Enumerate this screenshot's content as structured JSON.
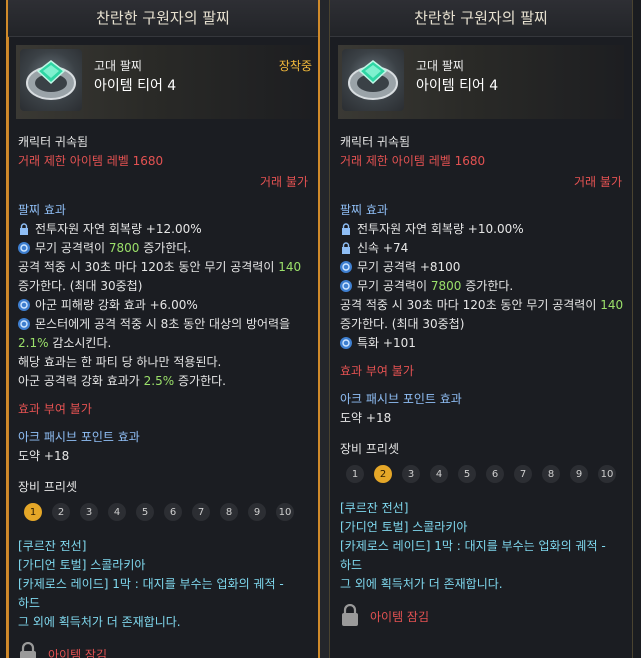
{
  "left_panel": {
    "title": "찬란한 구원자의 팔찌",
    "grade": "고대 팔찌",
    "tier": "아이템 티어 4",
    "equipped": "장착중",
    "bound": "캐릭터 귀속됨",
    "trade_level": "거래 제한 아이템 레벨 1680",
    "untradable": "거래 불가",
    "effect_header": "팔찌 효과",
    "effects": [
      {
        "icon": "lock-icon",
        "pre": "전투자원 자연 회복량 +12.00%",
        "val": "",
        "post": ""
      },
      {
        "icon": "swirl-icon",
        "pre": "무기 공격력이 ",
        "val": "7800",
        "post": " 증가한다."
      }
    ],
    "stack_line1_pre": "공격 적중 시 30초 마다 120초 동안 무기 공격력이 ",
    "stack_line1_val": "140",
    "stack_line2": "증가한다. (최대 30중첩)",
    "effect3": "아군 피해량 강화 효과 +6.00%",
    "effect4_line1": "몬스터에게 공격 적중 시 8초 동안 대상의 방어력을",
    "effect4_val": "2.1%",
    "effect4_post": " 감소시킨다.",
    "party_line": "해당 효과는 한 파티 당 하나만 적용된다.",
    "ally_pre": "아군 공격력 강화 효과가 ",
    "ally_val": "2.5%",
    "ally_post": " 증가한다.",
    "no_grant": "효과 부여 불가",
    "ark_header": "아크 패시브 포인트 효과",
    "ark_value": "도약 +18",
    "preset_header": "장비 프리셋",
    "presets": [
      "1",
      "2",
      "3",
      "4",
      "5",
      "6",
      "7",
      "8",
      "9",
      "10"
    ],
    "active_preset": 0,
    "source_header": "[쿠르잔 전선]",
    "source1": "[가디언 토벌] 스콜라키아",
    "source2_line1": "[카제로스 레이드] 1막 : 대지를 부수는 업화의 궤적 -",
    "source2_line2": "하드",
    "source_more": "그 외에 획득처가 더 존재합니다.",
    "lock_text": "아이템 잠김"
  },
  "right_panel": {
    "title": "찬란한 구원자의 팔찌",
    "grade": "고대 팔찌",
    "tier": "아이템 티어 4",
    "bound": "캐릭터 귀속됨",
    "trade_level": "거래 제한 아이템 레벨 1680",
    "untradable": "거래 불가",
    "effect_header": "팔찌 효과",
    "effects": [
      {
        "icon": "lock-icon",
        "pre": "전투자원 자연 회복량 +10.00%",
        "val": "",
        "post": ""
      },
      {
        "icon": "lock-icon",
        "pre": "신속 +74",
        "val": "",
        "post": ""
      },
      {
        "icon": "swirl-icon",
        "pre": "무기 공격력 +8100",
        "val": "",
        "post": ""
      },
      {
        "icon": "swirl-icon",
        "pre": "무기 공격력이 ",
        "val": "7800",
        "post": " 증가한다."
      }
    ],
    "stack_line1_pre": "공격 적중 시 30초 마다 120초 동안 무기 공격력이 ",
    "stack_line1_val": "140",
    "stack_line2": "증가한다. (최대 30중첩)",
    "effect_last": "특화 +101",
    "no_grant": "효과 부여 불가",
    "ark_header": "아크 패시브 포인트 효과",
    "ark_value": "도약 +18",
    "preset_header": "장비 프리셋",
    "presets": [
      "1",
      "2",
      "3",
      "4",
      "5",
      "6",
      "7",
      "8",
      "9",
      "10"
    ],
    "active_preset": 1,
    "source_header": "[쿠르잔 전선]",
    "source1": "[가디언 토벌] 스콜라키아",
    "source2_line1": "[카제로스 레이드] 1막 : 대지를 부수는 업화의 궤적 -",
    "source2_line2": "하드",
    "source_more": "그 외에 획득처가 더 존재합니다.",
    "lock_text": "아이템 잠김"
  },
  "colors": {
    "accent": "#e5a728",
    "red": "#e45252",
    "blue": "#8fbef5",
    "green": "#9be06a",
    "cyan": "#7fd8ee"
  }
}
